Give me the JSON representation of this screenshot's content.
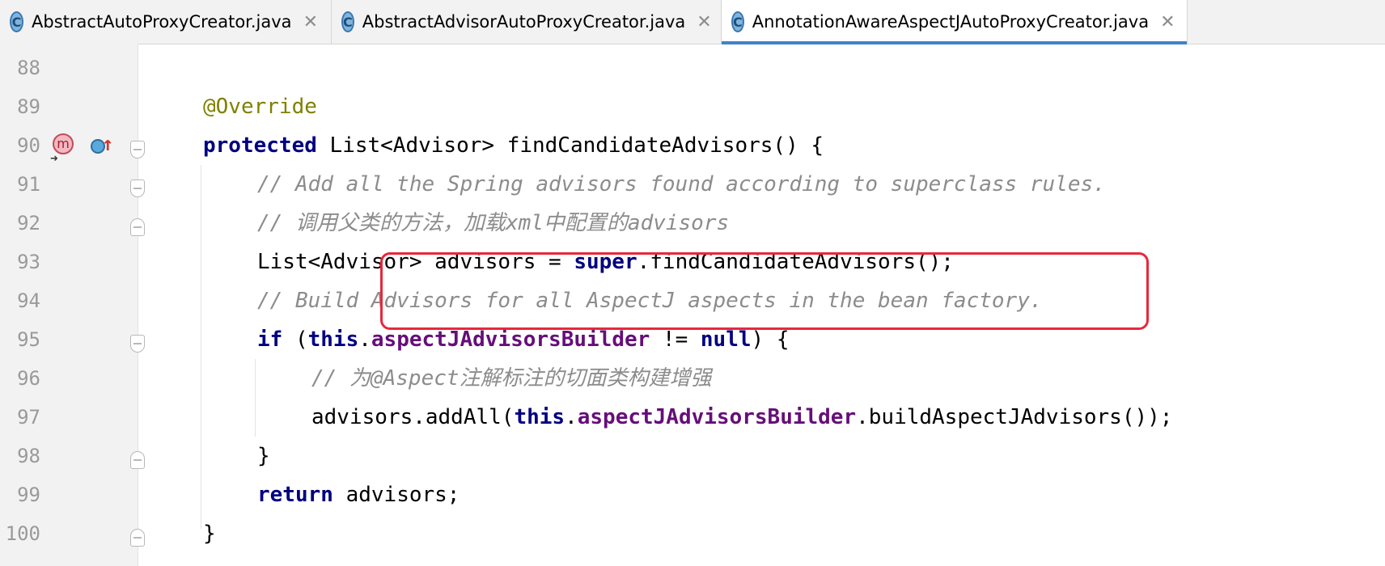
{
  "tabs": [
    {
      "label": "AbstractAutoProxyCreator.java",
      "icon": "C",
      "active": false
    },
    {
      "label": "AbstractAdvisorAutoProxyCreator.java",
      "icon": "C",
      "active": false
    },
    {
      "label": "AnnotationAwareAspectJAutoProxyCreator.java",
      "icon": "C",
      "active": true
    }
  ],
  "close_glyph": "✕",
  "gutter": {
    "line_numbers": [
      "88",
      "89",
      "90",
      "91",
      "92",
      "93",
      "94",
      "95",
      "96",
      "97",
      "98",
      "99",
      "100"
    ],
    "method_icon_letter": "m"
  },
  "code": {
    "l89": "@Override",
    "l90": {
      "kw": "protected",
      "rest": " List<Advisor> findCandidateAdvisors() {"
    },
    "l91": "// Add all the Spring advisors found according to superclass rules.",
    "l92": "// 调用父类的方法，加载xml中配置的advisors",
    "l93": {
      "pre": "List<Advisor> advisors = ",
      "kw": "super",
      "post": ".findCandidateAdvisors();"
    },
    "l94": "// Build Advisors for all AspectJ aspects in the bean factory.",
    "l95": {
      "kw1": "if",
      "p1": " (",
      "kw2": "this",
      "dot": ".",
      "field": "aspectJAdvisorsBuilder",
      "p2": " != ",
      "kw3": "null",
      "p3": ") {"
    },
    "l96": "// 为@Aspect注解标注的切面类构建增强",
    "l97": {
      "pre": "advisors.addAll(",
      "kw": "this",
      "dot": ".",
      "field": "aspectJAdvisorsBuilder",
      "post": ".buildAspectJAdvisors());"
    },
    "l98": "}",
    "l99": {
      "kw": "return",
      "rest": " advisors;"
    },
    "l100": "}"
  },
  "colors": {
    "keyword": "#000080",
    "annotation": "#808000",
    "comment": "#8c8c8c",
    "field": "#660e7a",
    "highlight_box": "#e8283c",
    "active_tab_underline": "#4083c9"
  }
}
